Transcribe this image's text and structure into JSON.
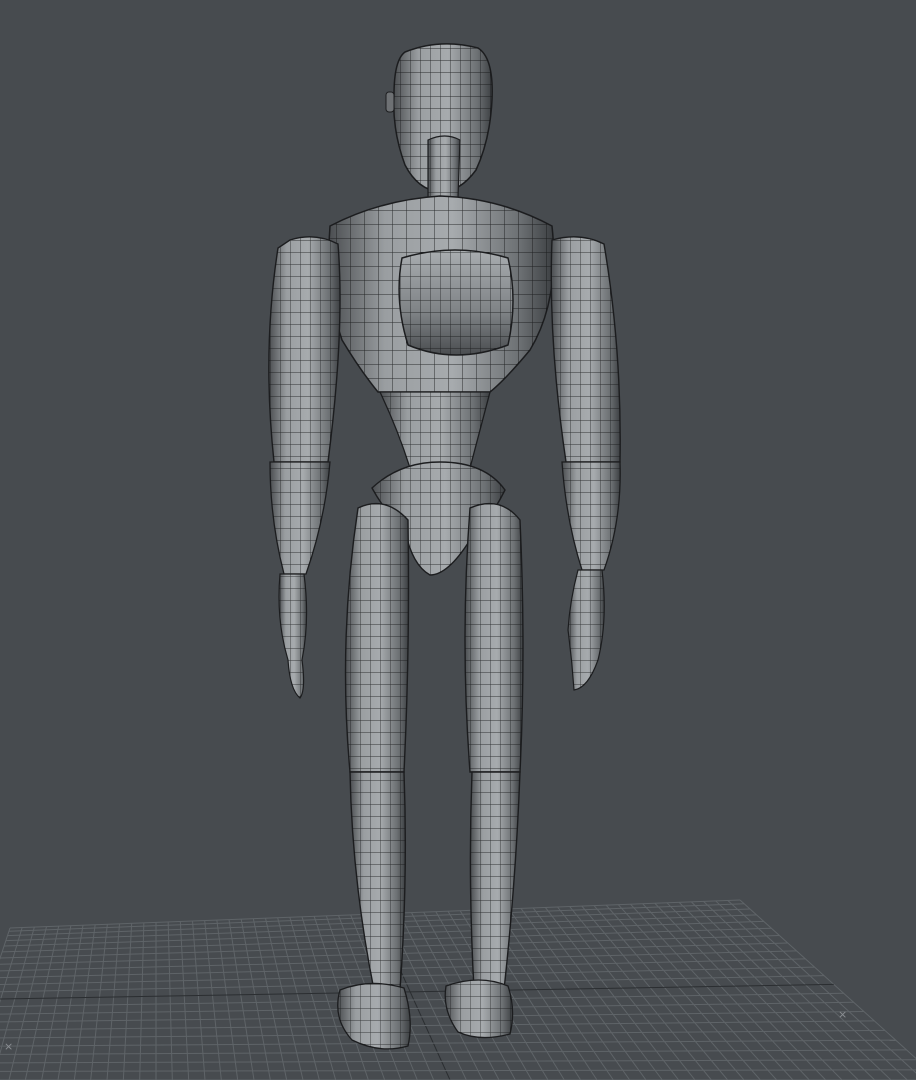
{
  "viewport": {
    "background_color": "#474b4f",
    "grid_color": "#5f6468",
    "grid_axis_color": "#2b2e31",
    "mesh_fill_color": "#8a8d90",
    "mesh_wire_color": "#151617",
    "axis_marker_icon": "x-axis-glyph"
  },
  "scene": {
    "object": "humanoid-mesh",
    "view": "back"
  }
}
